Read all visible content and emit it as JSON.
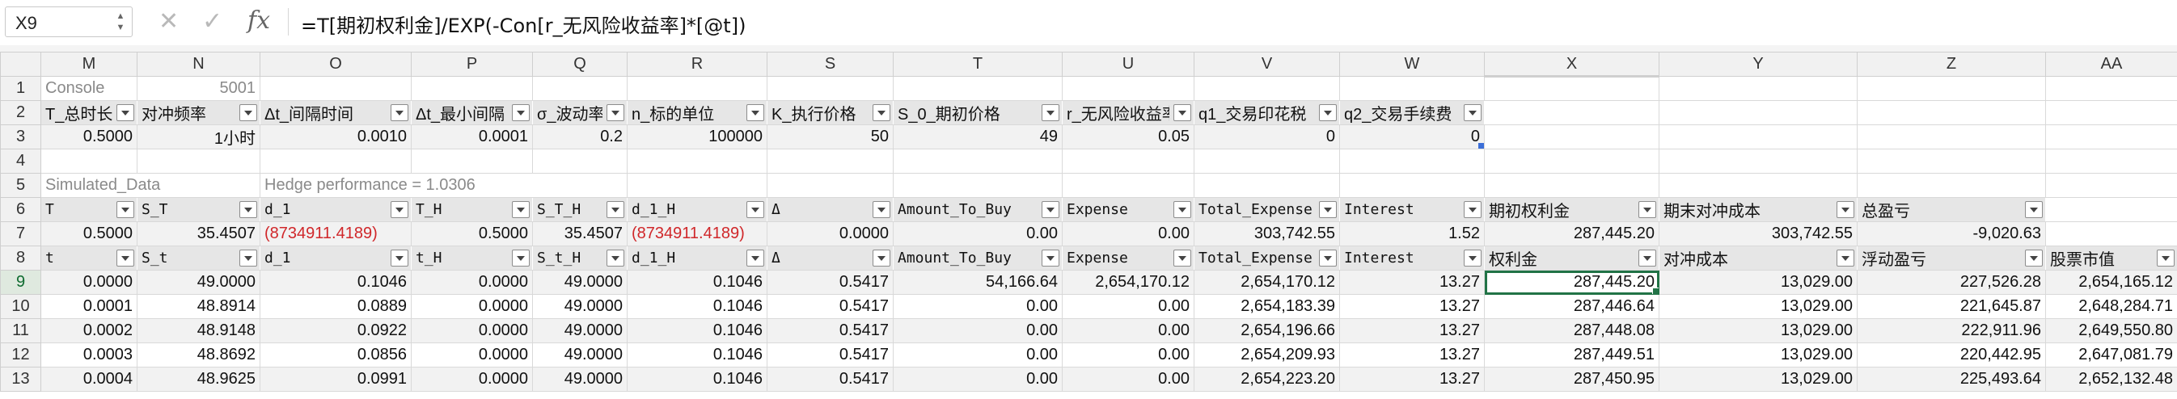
{
  "formula_bar": {
    "name_box": "X9",
    "cancel_icon": "close-icon",
    "confirm_icon": "check-icon",
    "fx_label": "fx",
    "formula": "=T[期初权利金]/EXP(-Con[r_无风险收益率]*[@t])"
  },
  "columns": [
    "M",
    "N",
    "O",
    "P",
    "Q",
    "R",
    "S",
    "T",
    "U",
    "V",
    "W",
    "X",
    "Y",
    "Z",
    "AA"
  ],
  "active_column": "X",
  "active_row": "9",
  "rows": {
    "r1": {
      "num": "1",
      "M": "Console",
      "N": "5001"
    },
    "r2": {
      "num": "2",
      "headers": [
        "T_总时长",
        "对冲频率",
        "Δt_间隔时间",
        "Δt_最小间隔",
        "σ_波动率",
        "n_标的单位",
        "K_执行价格",
        "S_0_期初价格",
        "r_无风险收益率",
        "q1_交易印花税",
        "q2_交易手续费"
      ]
    },
    "r3": {
      "num": "3",
      "values": [
        "0.5000",
        "1小时",
        "0.0010",
        "0.0001",
        "0.2",
        "100000",
        "50",
        "49",
        "0.05",
        "0",
        "0"
      ]
    },
    "r4": {
      "num": "4"
    },
    "r5": {
      "num": "5",
      "M": "Simulated_Data",
      "O": "Hedge performance = 1.0306"
    },
    "r6": {
      "num": "6",
      "headers": [
        "T",
        "S_T",
        "d_1",
        "T_H",
        "S_T_H",
        "d_1_H",
        "Δ",
        "Amount_To_Buy",
        "Expense",
        "Total_Expense",
        "Interest",
        "期初权利金",
        "期末对冲成本",
        "总盈亏"
      ]
    },
    "r7": {
      "num": "7",
      "values": [
        "0.5000",
        "35.4507",
        "(8734911.4189)",
        "0.5000",
        "35.4507",
        "(8734911.4189)",
        "0.0000",
        "0.00",
        "0.00",
        "303,742.55",
        "1.52",
        "287,445.20",
        "303,742.55",
        "-9,020.63"
      ]
    },
    "r8": {
      "num": "8",
      "headers": [
        "t",
        "S_t",
        "d_1",
        "t_H",
        "S_t_H",
        "d_1_H",
        "Δ",
        "Amount_To_Buy",
        "Expense",
        "Total_Expense",
        "Interest",
        "权利金",
        "对冲成本",
        "浮动盈亏",
        "股票市值"
      ]
    },
    "data": [
      {
        "num": "9",
        "values": [
          "0.0000",
          "49.0000",
          "0.1046",
          "0.0000",
          "49.0000",
          "0.1046",
          "0.5417",
          "54,166.64",
          "2,654,170.12",
          "2,654,170.12",
          "13.27",
          "287,445.20",
          "13,029.00",
          "227,526.28",
          "2,654,165.12"
        ]
      },
      {
        "num": "10",
        "values": [
          "0.0001",
          "48.8914",
          "0.0889",
          "0.0000",
          "49.0000",
          "0.1046",
          "0.5417",
          "0.00",
          "0.00",
          "2,654,183.39",
          "13.27",
          "287,446.64",
          "13,029.00",
          "221,645.87",
          "2,648,284.71"
        ]
      },
      {
        "num": "11",
        "values": [
          "0.0002",
          "48.9148",
          "0.0922",
          "0.0000",
          "49.0000",
          "0.1046",
          "0.5417",
          "0.00",
          "0.00",
          "2,654,196.66",
          "13.27",
          "287,448.08",
          "13,029.00",
          "222,911.96",
          "2,649,550.80"
        ]
      },
      {
        "num": "12",
        "values": [
          "0.0003",
          "48.8692",
          "0.0856",
          "0.0000",
          "49.0000",
          "0.1046",
          "0.5417",
          "0.00",
          "0.00",
          "2,654,209.93",
          "13.27",
          "287,449.51",
          "13,029.00",
          "220,442.95",
          "2,647,081.79"
        ]
      },
      {
        "num": "13",
        "values": [
          "0.0004",
          "48.9625",
          "0.0991",
          "0.0000",
          "49.0000",
          "0.1046",
          "0.5417",
          "0.00",
          "0.00",
          "2,654,223.20",
          "13.27",
          "287,450.95",
          "13,029.00",
          "225,493.64",
          "2,652,132.48"
        ]
      }
    ]
  },
  "colors": {
    "accent": "#217346",
    "negative": "#d0272a",
    "header_fill": "#e6e6e6",
    "band_fill": "#f2f2f2"
  }
}
